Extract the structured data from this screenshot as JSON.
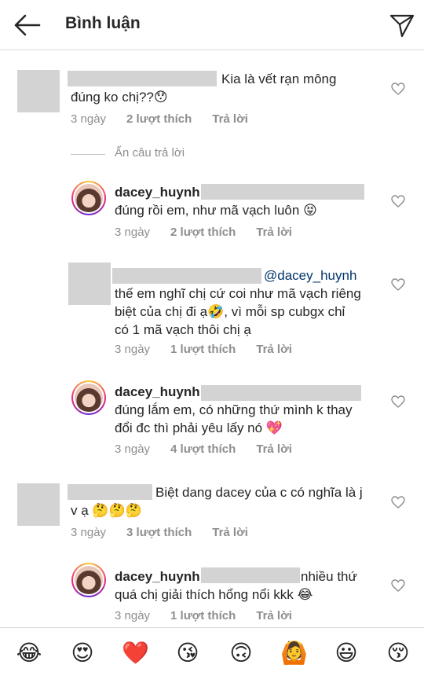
{
  "header": {
    "title": "Bình luận"
  },
  "comments": [
    {
      "text1": "Kia là vết rạn mông",
      "text2": "đúng ko chị??😯",
      "time": "3 ngày",
      "likes": "2 lượt thích",
      "reply": "Trả lời"
    },
    {
      "hide_replies": "Ẩn câu trả lời"
    },
    {
      "username": "dacey_huynh",
      "text1": "đúng rồi em, như mã vạch luôn 😝",
      "time": "3 ngày",
      "likes": "2 lượt thích",
      "reply": "Trả lời"
    },
    {
      "mention": "@dacey_huynh",
      "text1": "thế em nghĩ chị cứ coi như mã vạch riêng",
      "text2": "biệt của chị đi ạ🤣, vì mỗi sp cubgx chỉ",
      "text3": "có 1 mã vạch thôi chị ạ",
      "time": "3 ngày",
      "likes": "1 lượt thích",
      "reply": "Trả lời"
    },
    {
      "username": "dacey_huynh",
      "text1": "đúng lắm em, có những thứ mình k thay",
      "text2": "đổi đc thì phải yêu lấy nó 💖",
      "time": "3 ngày",
      "likes": "4 lượt thích",
      "reply": "Trả lời"
    },
    {
      "text1": "Biệt dang dacey của c có nghĩa là j",
      "text2": "v ạ 🤔🤔🤔",
      "time": "3 ngày",
      "likes": "3 lượt thích",
      "reply": "Trả lời"
    },
    {
      "username": "dacey_huynh",
      "text1": "nhiều thứ",
      "text2": "quá chị giải thích hổng nổi kkk 😂",
      "time": "3 ngày",
      "likes": "1 lượt thích",
      "reply": "Trả lời"
    }
  ],
  "emoji_bar": [
    "😂",
    "😍",
    "❤️",
    "😘",
    "🙃",
    "🙆",
    "😃",
    "😚"
  ],
  "colors": {
    "text": "#262626",
    "meta": "#8e8e8e",
    "mention": "#003569",
    "divider": "#dbdbdb"
  }
}
